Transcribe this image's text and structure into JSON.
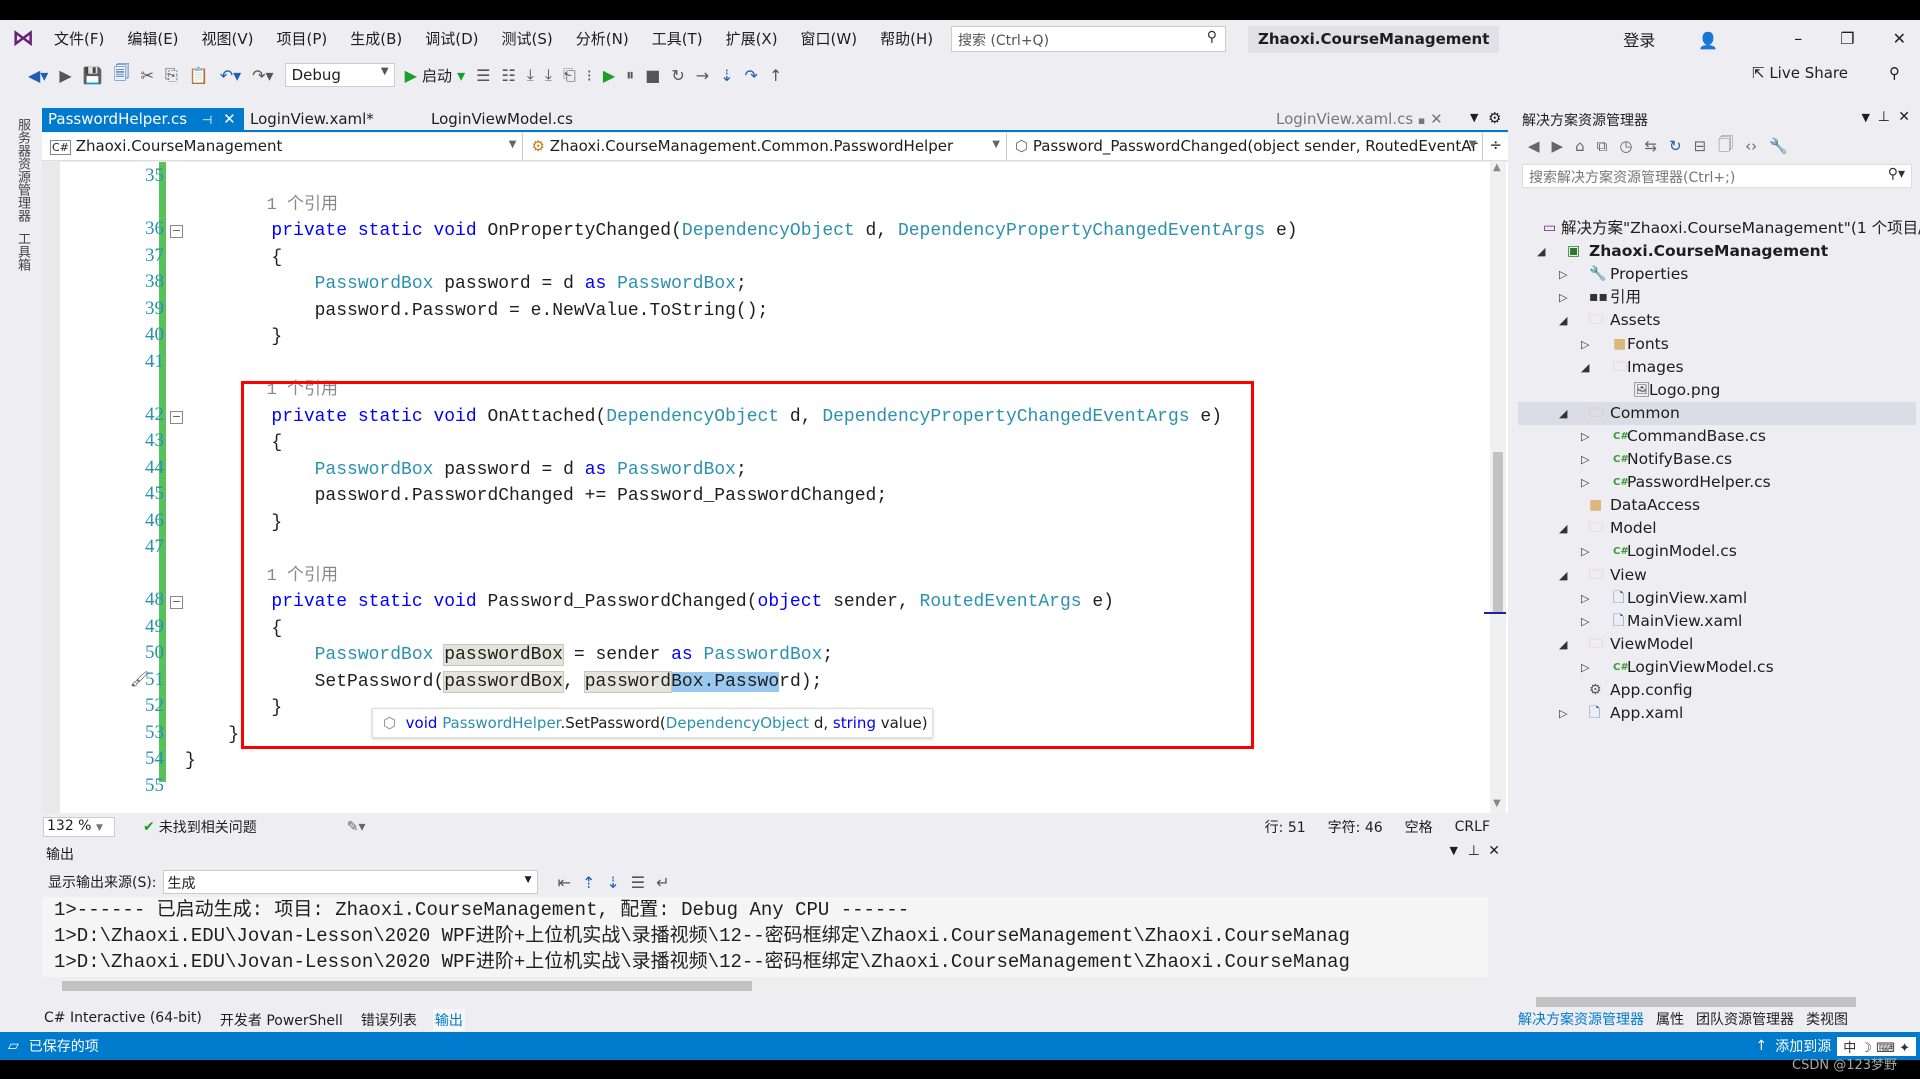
{
  "menu": [
    "文件(F)",
    "编辑(E)",
    "视图(V)",
    "项目(P)",
    "生成(B)",
    "调试(D)",
    "测试(S)",
    "分析(N)",
    "工具(T)",
    "扩展(X)",
    "窗口(W)",
    "帮助(H)"
  ],
  "search_placeholder": "搜索 (Ctrl+Q)",
  "window_title": "Zhaoxi.CourseManagement",
  "signin": "登录",
  "toolbar": {
    "config": "Debug",
    "start": "启动",
    "live_share": "Live Share"
  },
  "left_strip": [
    "服务器资源管理器",
    "工具箱"
  ],
  "doc_tabs": [
    {
      "label": "PasswordHelper.cs",
      "active": true
    },
    {
      "label": "LoginView.xaml*"
    },
    {
      "label": "LoginViewModel.cs"
    }
  ],
  "preview_tab": "LoginView.xaml.cs",
  "navbar": {
    "project": "Zhaoxi.CourseManagement",
    "class": "Zhaoxi.CourseManagement.Common.PasswordHelper",
    "member": "Password_PasswordChanged(object sender, RoutedEventAr"
  },
  "code": [
    {
      "n": "35",
      "tokens": []
    },
    {
      "n": "",
      "tokens": [
        {
          "t": "        1 个引用",
          "c": "lens"
        }
      ]
    },
    {
      "n": "36",
      "fold": true,
      "tokens": [
        {
          "t": "        "
        },
        {
          "t": "private static void",
          "c": "kw"
        },
        {
          "t": " OnPropertyChanged("
        },
        {
          "t": "DependencyObject",
          "c": "ty"
        },
        {
          "t": " d, "
        },
        {
          "t": "DependencyPropertyChangedEventArgs",
          "c": "ty"
        },
        {
          "t": " e)"
        }
      ]
    },
    {
      "n": "37",
      "tokens": [
        {
          "t": "        {"
        }
      ]
    },
    {
      "n": "38",
      "tokens": [
        {
          "t": "            "
        },
        {
          "t": "PasswordBox",
          "c": "ty"
        },
        {
          "t": " password = d "
        },
        {
          "t": "as",
          "c": "kw"
        },
        {
          "t": " "
        },
        {
          "t": "PasswordBox",
          "c": "ty"
        },
        {
          "t": ";"
        }
      ]
    },
    {
      "n": "39",
      "tokens": [
        {
          "t": "            password.Password = e.NewValue.ToString();"
        }
      ]
    },
    {
      "n": "40",
      "tokens": [
        {
          "t": "        }"
        }
      ]
    },
    {
      "n": "41",
      "tokens": []
    },
    {
      "n": "",
      "tokens": [
        {
          "t": "        1 个引用",
          "c": "lens"
        }
      ]
    },
    {
      "n": "42",
      "fold": true,
      "tokens": [
        {
          "t": "        "
        },
        {
          "t": "private static void",
          "c": "kw"
        },
        {
          "t": " OnAttached("
        },
        {
          "t": "DependencyObject",
          "c": "ty"
        },
        {
          "t": " d, "
        },
        {
          "t": "DependencyPropertyChangedEventArgs",
          "c": "ty"
        },
        {
          "t": " e)"
        }
      ]
    },
    {
      "n": "43",
      "tokens": [
        {
          "t": "        {"
        }
      ]
    },
    {
      "n": "44",
      "tokens": [
        {
          "t": "            "
        },
        {
          "t": "PasswordBox",
          "c": "ty"
        },
        {
          "t": " password = d "
        },
        {
          "t": "as",
          "c": "kw"
        },
        {
          "t": " "
        },
        {
          "t": "PasswordBox",
          "c": "ty"
        },
        {
          "t": ";"
        }
      ]
    },
    {
      "n": "45",
      "tokens": [
        {
          "t": "            password.PasswordChanged += Password_PasswordChanged;"
        }
      ]
    },
    {
      "n": "46",
      "tokens": [
        {
          "t": "        }"
        }
      ]
    },
    {
      "n": "47",
      "tokens": []
    },
    {
      "n": "",
      "tokens": [
        {
          "t": "        1 个引用",
          "c": "lens"
        }
      ]
    },
    {
      "n": "48",
      "fold": true,
      "tokens": [
        {
          "t": "        "
        },
        {
          "t": "private static void",
          "c": "kw"
        },
        {
          "t": " Password_PasswordChanged("
        },
        {
          "t": "object",
          "c": "kw"
        },
        {
          "t": " sender, "
        },
        {
          "t": "RoutedEventArgs",
          "c": "ty"
        },
        {
          "t": " e)"
        }
      ]
    },
    {
      "n": "49",
      "tokens": [
        {
          "t": "        {"
        }
      ]
    },
    {
      "n": "50",
      "tokens": [
        {
          "t": "            "
        },
        {
          "t": "PasswordBox",
          "c": "ty"
        },
        {
          "t": " "
        },
        {
          "t": "passwordBox",
          "c": "hl"
        },
        {
          "t": " = sender "
        },
        {
          "t": "as",
          "c": "kw"
        },
        {
          "t": " "
        },
        {
          "t": "PasswordBox",
          "c": "ty"
        },
        {
          "t": ";"
        }
      ]
    },
    {
      "n": "51",
      "quickaction": true,
      "tokens": [
        {
          "t": "            SetPassword("
        },
        {
          "t": "passwordBox",
          "c": "hl"
        },
        {
          "t": ", "
        },
        {
          "t": "password",
          "c": "hl"
        },
        {
          "t": "Box.Passwo",
          "c": "sel"
        },
        {
          "t": "rd);"
        }
      ]
    },
    {
      "n": "52",
      "tokens": [
        {
          "t": "        }"
        }
      ]
    },
    {
      "n": "53",
      "tokens": [
        {
          "t": "    }"
        }
      ]
    },
    {
      "n": "54",
      "tokens": [
        {
          "t": "}"
        }
      ]
    },
    {
      "n": "55",
      "tokens": []
    }
  ],
  "tooltip": {
    "ret": "void",
    "cls": "PasswordHelper",
    "method": ".SetPassword(",
    "ptype1": "DependencyObject",
    "p1": " d, ",
    "ptype2": "string",
    "p2": " value)"
  },
  "editor_status": {
    "zoom": "132 %",
    "issues": "未找到相关问题",
    "line": "行: 51",
    "char": "字符: 46",
    "spaces": "空格",
    "eol": "CRLF"
  },
  "output": {
    "title": "输出",
    "source_label": "显示输出来源(S):",
    "source_value": "生成",
    "lines": [
      "1>------ 已启动生成: 项目: Zhaoxi.CourseManagement, 配置: Debug Any CPU ------",
      "1>D:\\Zhaoxi.EDU\\Jovan-Lesson\\2020 WPF进阶+上位机实战\\录播视频\\12--密码框绑定\\Zhaoxi.CourseManagement\\Zhaoxi.CourseManag",
      "1>D:\\Zhaoxi.EDU\\Jovan-Lesson\\2020 WPF进阶+上位机实战\\录播视频\\12--密码框绑定\\Zhaoxi.CourseManagement\\Zhaoxi.CourseManag"
    ]
  },
  "bottom_tabs": [
    {
      "label": "C# Interactive (64-bit)"
    },
    {
      "label": "开发者 PowerShell"
    },
    {
      "label": "错误列表"
    },
    {
      "label": "输出",
      "active": true
    }
  ],
  "solution": {
    "title": "解决方案资源管理器",
    "search_placeholder": "搜索解决方案资源管理器(Ctrl+;)",
    "nodes": [
      {
        "label": "解决方案\"Zhaoxi.CourseManagement\"(1 个项目/共",
        "level": 0,
        "icon": "solution-icon"
      },
      {
        "label": "Zhaoxi.CourseManagement",
        "level": 1,
        "arrow": "open",
        "icon": "csproj-icon",
        "bold": true
      },
      {
        "label": "Properties",
        "level": 2,
        "arrow": "closed",
        "icon": "wrench-icon"
      },
      {
        "label": "引用",
        "level": 2,
        "arrow": "closed",
        "icon": "references-icon"
      },
      {
        "label": "Assets",
        "level": 2,
        "arrow": "open",
        "icon": "folder-open-icon"
      },
      {
        "label": "Fonts",
        "level": 3,
        "arrow": "closed",
        "icon": "folder-icon"
      },
      {
        "label": "Images",
        "level": 3,
        "arrow": "open",
        "icon": "folder-open-icon"
      },
      {
        "label": "Logo.png",
        "level": 4,
        "icon": "image-icon"
      },
      {
        "label": "Common",
        "level": 2,
        "arrow": "open",
        "icon": "folder-open-icon",
        "selected": true
      },
      {
        "label": "CommandBase.cs",
        "level": 3,
        "arrow": "closed",
        "icon": "csharp-file-icon"
      },
      {
        "label": "NotifyBase.cs",
        "level": 3,
        "arrow": "closed",
        "icon": "csharp-file-icon"
      },
      {
        "label": "PasswordHelper.cs",
        "level": 3,
        "arrow": "closed",
        "icon": "csharp-file-icon"
      },
      {
        "label": "DataAccess",
        "level": 2,
        "icon": "folder-icon"
      },
      {
        "label": "Model",
        "level": 2,
        "arrow": "open",
        "icon": "folder-open-icon"
      },
      {
        "label": "LoginModel.cs",
        "level": 3,
        "arrow": "closed",
        "icon": "csharp-file-icon"
      },
      {
        "label": "View",
        "level": 2,
        "arrow": "open",
        "icon": "folder-open-icon"
      },
      {
        "label": "LoginView.xaml",
        "level": 3,
        "arrow": "closed",
        "icon": "xaml-file-icon"
      },
      {
        "label": "MainView.xaml",
        "level": 3,
        "arrow": "closed",
        "icon": "xaml-file-icon"
      },
      {
        "label": "ViewModel",
        "level": 2,
        "arrow": "open",
        "icon": "folder-open-icon"
      },
      {
        "label": "LoginViewModel.cs",
        "level": 3,
        "arrow": "closed",
        "icon": "csharp-file-icon"
      },
      {
        "label": "App.config",
        "level": 2,
        "icon": "config-file-icon"
      },
      {
        "label": "App.xaml",
        "level": 2,
        "arrow": "closed",
        "icon": "xaml-file-icon"
      }
    ],
    "footer_tabs": [
      {
        "label": "解决方案资源管理器",
        "active": true
      },
      {
        "label": "属性"
      },
      {
        "label": "团队资源管理器"
      },
      {
        "label": "类视图"
      }
    ]
  },
  "statusbar": {
    "left": "已保存的项",
    "right": "添加到源",
    "ime": "中",
    "watermark": "CSDN @123梦野"
  },
  "colors": {
    "accent": "#007acc",
    "keyword": "#0000ff",
    "type": "#2b91af",
    "highlight_box": "#ff0000"
  }
}
